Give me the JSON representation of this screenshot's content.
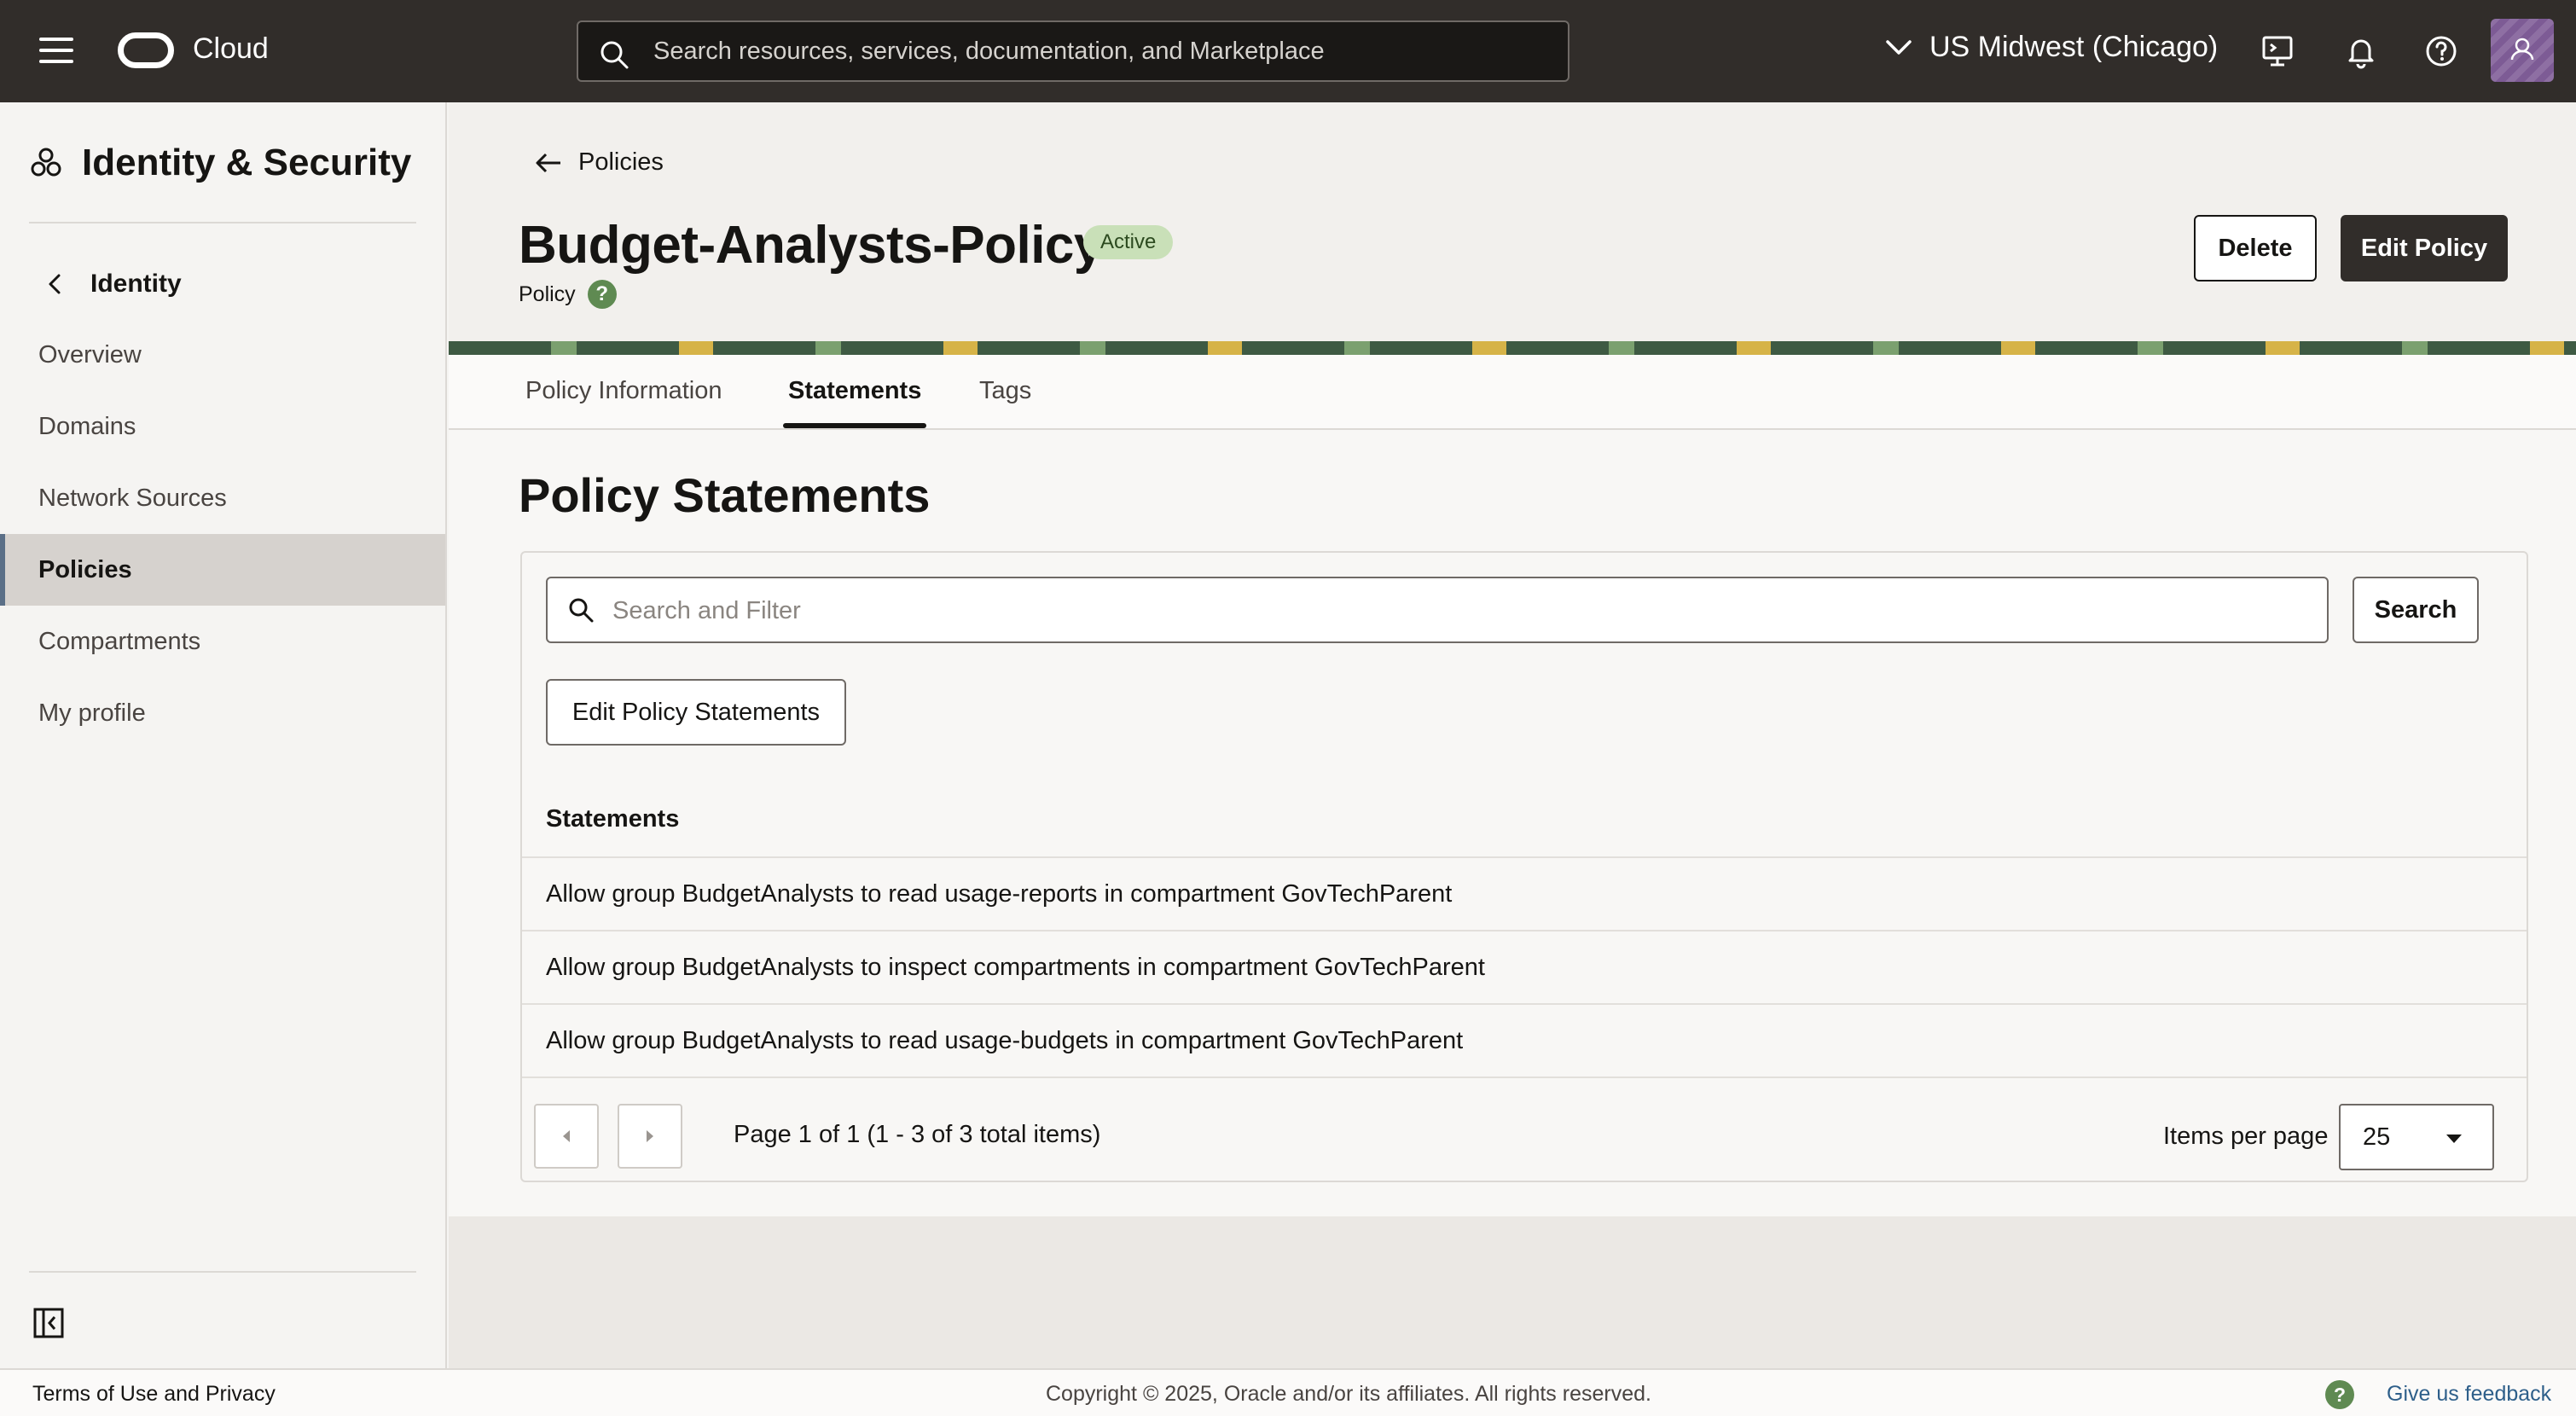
{
  "topbar": {
    "brand": "Cloud",
    "search_placeholder": "Search resources, services, documentation, and Marketplace",
    "region": "US Midwest (Chicago)"
  },
  "sidebar": {
    "title": "Identity & Security",
    "back_label": "Identity",
    "items": [
      {
        "label": "Overview",
        "active": false
      },
      {
        "label": "Domains",
        "active": false
      },
      {
        "label": "Network Sources",
        "active": false
      },
      {
        "label": "Policies",
        "active": true
      },
      {
        "label": "Compartments",
        "active": false
      },
      {
        "label": "My profile",
        "active": false
      }
    ]
  },
  "header": {
    "back_link": "Policies",
    "title": "Budget-Analysts-Policy",
    "status": "Active",
    "resource_type": "Policy",
    "help_glyph": "?",
    "delete_label": "Delete",
    "edit_label": "Edit Policy"
  },
  "tabs": [
    {
      "label": "Policy Information",
      "active": false
    },
    {
      "label": "Statements",
      "active": true
    },
    {
      "label": "Tags",
      "active": false
    }
  ],
  "statements": {
    "section_title": "Policy Statements",
    "filter_placeholder": "Search and Filter",
    "search_label": "Search",
    "edit_label": "Edit Policy Statements",
    "column_header": "Statements",
    "rows": [
      "Allow group BudgetAnalysts to read usage-reports in compartment GovTechParent",
      "Allow group BudgetAnalysts to inspect compartments in compartment GovTechParent",
      "Allow group BudgetAnalysts to read usage-budgets in compartment GovTechParent"
    ],
    "page_info": "Page 1 of 1 (1 - 3 of 3 total items)",
    "items_per_page_label": "Items per page",
    "items_per_page_value": "25"
  },
  "footer": {
    "terms": "Terms of Use and Privacy",
    "copyright": "Copyright © 2025, Oracle and/or its affiliates. All rights reserved.",
    "feedback": "Give us feedback",
    "help_glyph": "?"
  },
  "icons": {
    "menu": "hamburger-menu-icon",
    "search": "search-icon",
    "region": "chevron-down-icon",
    "cloud_shell": "cloud-shell-icon",
    "notifications": "bell-icon",
    "help": "help-icon",
    "service": "identity-security-icon",
    "back": "chevron-left-icon",
    "arrow_back": "arrow-left-icon",
    "collapse": "sidebar-collapse-icon"
  },
  "colors": {
    "topbar": "#312d2a",
    "active_badge": "#c9e0b8",
    "help_green": "#5f8a52",
    "link_blue": "#2e5f8a"
  }
}
